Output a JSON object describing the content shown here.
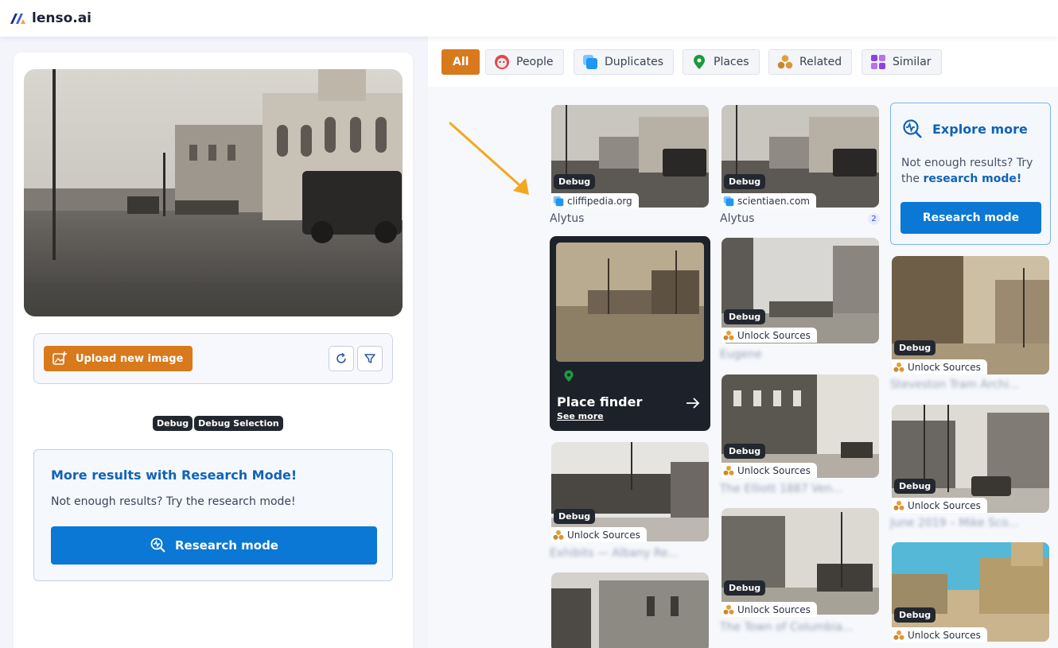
{
  "app": {
    "logo_text": "lenso.ai"
  },
  "left": {
    "upload_label": "Upload new image",
    "debug_badges": [
      "Debug",
      "Debug Selection"
    ],
    "research_box": {
      "title": "More results with Research Mode!",
      "subtitle": "Not enough results? Try the research mode!",
      "button_label": "Research mode"
    }
  },
  "filters": [
    {
      "label": "All",
      "active": true
    },
    {
      "label": "People",
      "icon": "face-icon"
    },
    {
      "label": "Duplicates",
      "icon": "duplicate-icon"
    },
    {
      "label": "Places",
      "icon": "map-pin-icon"
    },
    {
      "label": "Related",
      "icon": "related-icon"
    },
    {
      "label": "Similar",
      "icon": "grid-icon"
    }
  ],
  "results": {
    "debug_tag": "Debug",
    "unlock_label": "Unlock Sources",
    "col1": [
      {
        "source": "cliffipedia.org",
        "title": "Alytus"
      },
      {
        "blurred_title": "Exhibits — Albany Re..."
      }
    ],
    "col2": [
      {
        "source": "scientiaen.com",
        "title": "Alytus",
        "count": "2"
      },
      {
        "blurred_title": "Eugene"
      },
      {
        "blurred_title": "The Elliott 1887 Ven..."
      },
      {
        "blurred_title": "The Town of Columbia..."
      }
    ],
    "col3": [
      {
        "blurred_title": "Steveston Tram Archi..."
      },
      {
        "blurred_title": "June 2019 – Mike Sco..."
      }
    ],
    "place_finder": {
      "title": "Place finder",
      "link": "See more"
    },
    "explore": {
      "title": "Explore more",
      "text_plain": "Not enough results? Try the",
      "text_link": "research mode!",
      "button_label": "Research mode"
    }
  },
  "colors": {
    "accent_orange": "#d8791c",
    "brand_blue": "#0a78d4",
    "title_blue": "#1163b4",
    "dark_tag": "#23272f"
  }
}
